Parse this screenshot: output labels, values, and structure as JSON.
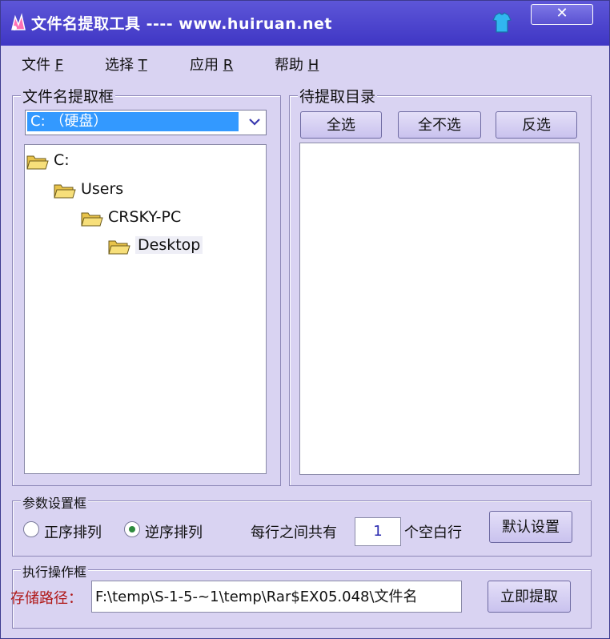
{
  "window": {
    "title": "文件名提取工具 ---- www.huiruan.net",
    "close_label": "✕",
    "accent_color": "#4a43cc",
    "background_color": "#d9d3f2"
  },
  "menu": {
    "items": [
      {
        "label": "文件 ",
        "accel": "F"
      },
      {
        "label": "选择 ",
        "accel": "T"
      },
      {
        "label": "应用 ",
        "accel": "R"
      },
      {
        "label": "帮助 ",
        "accel": "H"
      }
    ]
  },
  "left_group": {
    "legend": "文件名提取框",
    "drive": "C: （硬盘）",
    "tree": [
      {
        "label": "C:",
        "icon": "folder-open-icon"
      },
      {
        "label": "Users",
        "icon": "folder-open-icon"
      },
      {
        "label": "CRSKY-PC",
        "icon": "folder-open-icon"
      },
      {
        "label": "Desktop",
        "icon": "folder-open-icon",
        "selected": true
      }
    ]
  },
  "right_group": {
    "legend": "待提取目录",
    "select_all": "全选",
    "select_none": "全不选",
    "invert": "反选"
  },
  "params": {
    "legend": "参数设置框",
    "ascending": "正序排列",
    "descending": "逆序排列",
    "selected_order": "descending",
    "per_line_prefix": "每行之间共有",
    "blank_count": "1",
    "per_line_suffix": "个空白行",
    "default_button": "默认设置"
  },
  "execute": {
    "legend": "执行操作框",
    "path_label": "存储路径：",
    "path_value": "F:\\temp\\S-1-5-~1\\temp\\Rar$EX05.048\\文件名",
    "extract_button": "立即提取"
  }
}
